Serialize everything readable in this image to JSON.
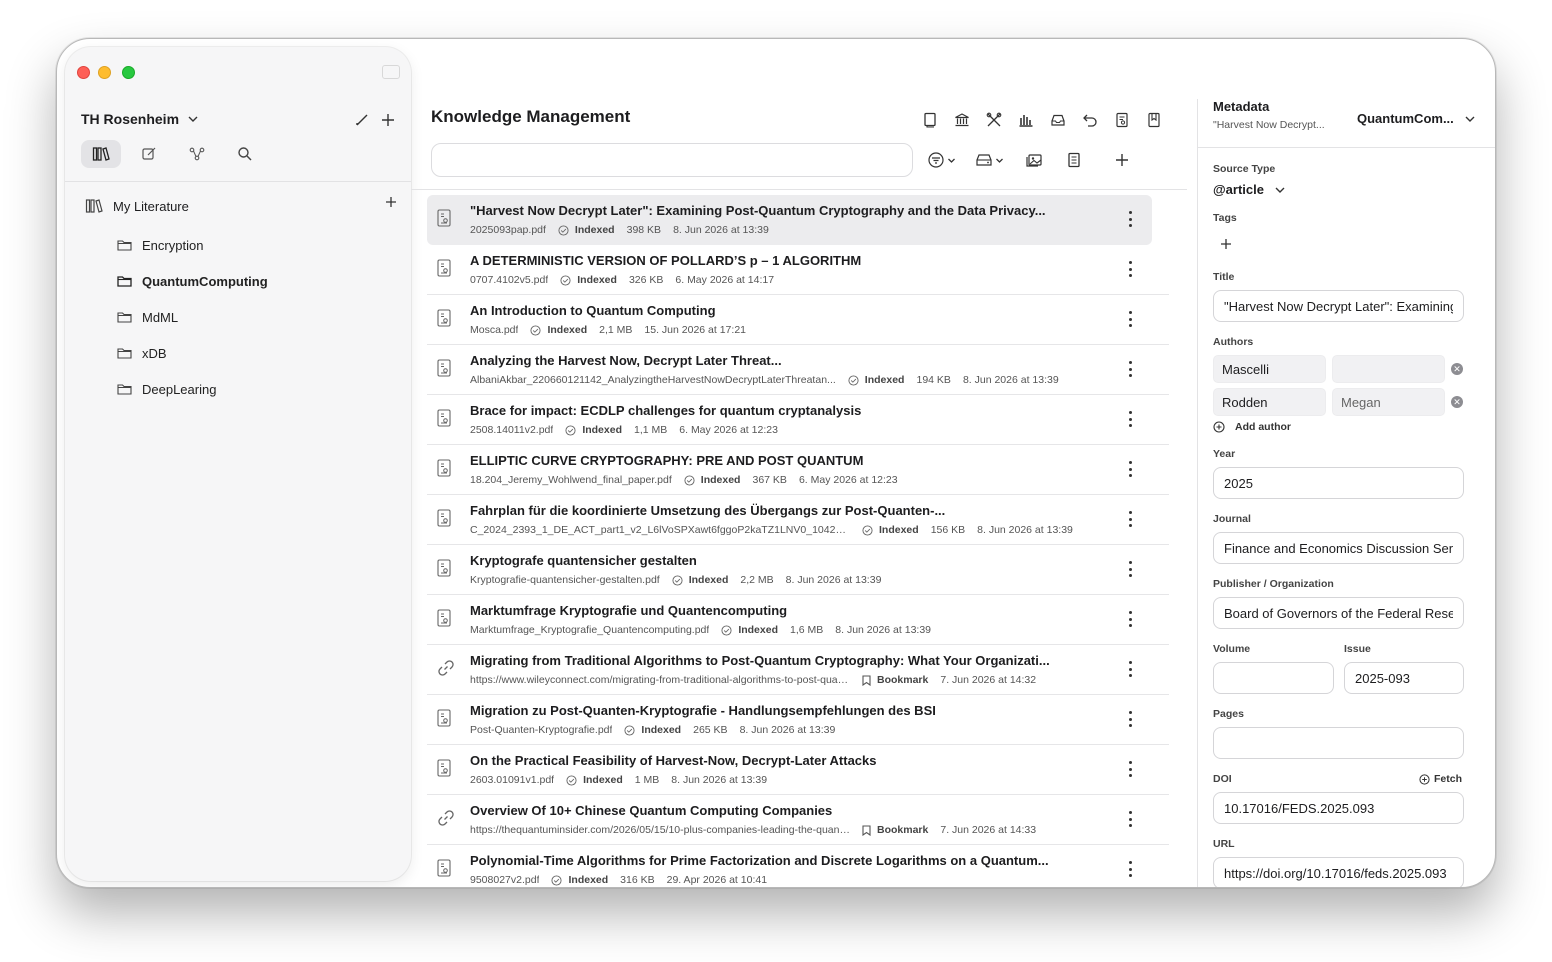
{
  "sidebar": {
    "workspace": "TH Rosenheim",
    "library_root": "My Literature",
    "folders": [
      {
        "label": "Encryption",
        "active": false
      },
      {
        "label": "QuantumComputing",
        "active": true
      },
      {
        "label": "MdML",
        "active": false
      },
      {
        "label": "xDB",
        "active": false
      },
      {
        "label": "DeepLearing",
        "active": false
      }
    ]
  },
  "main": {
    "title": "Knowledge Management",
    "search": {
      "value": "",
      "placeholder": ""
    },
    "documents": [
      {
        "title": "\"Harvest Now Decrypt Later\": Examining Post-Quantum Cryptography and the Data Privacy...",
        "file": "2025093pap.pdf",
        "kind": "pdf",
        "status": "Indexed",
        "size": "398 KB",
        "date": "8. Jun 2026 at 13:39"
      },
      {
        "title": "A DETERMINISTIC VERSION OF POLLARD’S p – 1 ALGORITHM",
        "file": "0707.4102v5.pdf",
        "kind": "pdf",
        "status": "Indexed",
        "size": "326 KB",
        "date": "6. May 2026 at 14:17"
      },
      {
        "title": "An Introduction to Quantum Computing",
        "file": "Mosca.pdf",
        "kind": "pdf",
        "status": "Indexed",
        "size": "2,1 MB",
        "date": "15. Jun 2026 at 17:21"
      },
      {
        "title": "Analyzing the Harvest Now, Decrypt Later Threat...",
        "file": "AlbaniAkbar_220660121142_AnalyzingtheHarvestNowDecryptLaterThreatan...",
        "kind": "pdf",
        "status": "Indexed",
        "size": "194 KB",
        "date": "8. Jun 2026 at 13:39"
      },
      {
        "title": "Brace for impact: ECDLP challenges for quantum cryptanalysis",
        "file": "2508.14011v2.pdf",
        "kind": "pdf",
        "status": "Indexed",
        "size": "1,1 MB",
        "date": "6. May 2026 at 12:23"
      },
      {
        "title": "ELLIPTIC CURVE CRYPTOGRAPHY: PRE AND POST QUANTUM",
        "file": "18.204_Jeremy_Wohlwend_final_paper.pdf",
        "kind": "pdf",
        "status": "Indexed",
        "size": "367 KB",
        "date": "6. May 2026 at 12:23"
      },
      {
        "title": "Fahrplan für die koordinierte Umsetzung des Übergangs zur Post-Quanten-...",
        "file": "C_2024_2393_1_DE_ACT_part1_v2_L6lVoSPXawt6fggoP2kaTZ1LNV0_10423...",
        "kind": "pdf",
        "status": "Indexed",
        "size": "156 KB",
        "date": "8. Jun 2026 at 13:39"
      },
      {
        "title": "Kryptografe quantensicher gestalten",
        "file": "Kryptografie-quantensicher-gestalten.pdf",
        "kind": "pdf",
        "status": "Indexed",
        "size": "2,2 MB",
        "date": "8. Jun 2026 at 13:39"
      },
      {
        "title": "Marktumfrage Kryptografie und Quantencomputing",
        "file": "Marktumfrage_Kryptografie_Quantencomputing.pdf",
        "kind": "pdf",
        "status": "Indexed",
        "size": "1,6 MB",
        "date": "8. Jun 2026 at 13:39"
      },
      {
        "title": "Migrating from Traditional Algorithms to Post-Quantum Cryptography: What Your Organizati...",
        "file": "https://www.wileyconnect.com/migrating-from-traditional-algorithms-to-post-quant...",
        "kind": "link",
        "status": "Bookmark",
        "size": "",
        "date": "7. Jun 2026 at 14:32"
      },
      {
        "title": "Migration zu Post-Quanten-Kryptografie - Handlungsempfehlungen des BSI",
        "file": "Post-Quanten-Kryptografie.pdf",
        "kind": "pdf",
        "status": "Indexed",
        "size": "265 KB",
        "date": "8. Jun 2026 at 13:39"
      },
      {
        "title": "On the Practical Feasibility of Harvest-Now, Decrypt-Later Attacks",
        "file": "2603.01091v1.pdf",
        "kind": "pdf",
        "status": "Indexed",
        "size": "1 MB",
        "date": "8. Jun 2026 at 13:39"
      },
      {
        "title": "Overview Of 10+ Chinese Quantum Computing Companies",
        "file": "https://thequantuminsider.com/2026/05/15/10-plus-companies-leading-the-quantu...",
        "kind": "link",
        "status": "Bookmark",
        "size": "",
        "date": "7. Jun 2026 at 14:33"
      },
      {
        "title": "Polynomial-Time Algorithms for Prime Factorization and Discrete Logarithms on a Quantum...",
        "file": "9508027v2.pdf",
        "kind": "pdf",
        "status": "Indexed",
        "size": "316 KB",
        "date": "29. Apr 2026 at 10:41"
      }
    ]
  },
  "metadata": {
    "title": "Metadata",
    "subtitle": "\"Harvest Now Decrypt...",
    "collection": "QuantumCom...",
    "source_type_label": "Source Type",
    "source_type": "@article",
    "tags_label": "Tags",
    "title_label": "Title",
    "title_value": "\"Harvest Now Decrypt Later\": Examining Post-Quantum Cryptography and the Data Privacy",
    "authors_label": "Authors",
    "authors": [
      {
        "last": "Mascelli",
        "first": ""
      },
      {
        "last": "Rodden",
        "first": "Megan"
      }
    ],
    "add_author": "Add author",
    "year_label": "Year",
    "year": "2025",
    "journal_label": "Journal",
    "journal": "Finance and Economics Discussion Series",
    "publisher_label": "Publisher / Organization",
    "publisher": "Board of Governors of the Federal Reserve System",
    "volume_label": "Volume",
    "volume": "",
    "issue_label": "Issue",
    "issue": "2025-093",
    "pages_label": "Pages",
    "pages": "",
    "doi_label": "DOI",
    "fetch": "Fetch",
    "doi": "10.17016/FEDS.2025.093",
    "url_label": "URL",
    "url": "https://doi.org/10.17016/feds.2025.093"
  },
  "colors": {
    "traffic_red": "#fe5f57",
    "traffic_yellow": "#febc2e",
    "traffic_green": "#28c840",
    "selected_row": "#ececee"
  }
}
